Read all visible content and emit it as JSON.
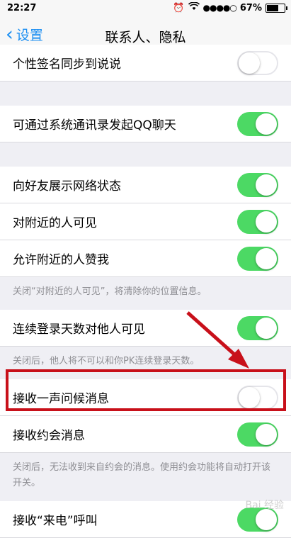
{
  "status_bar": {
    "time": "22:27",
    "signal_dots": "●●●●○",
    "battery": "67%",
    "battery_level": 0.67
  },
  "nav": {
    "back_label": "设置",
    "title": "联系人、隐私"
  },
  "sections": [
    {
      "rows": [
        {
          "label": "个性签名同步到说说",
          "on": false
        }
      ]
    },
    {
      "rows": [
        {
          "label": "可通过系统通讯录发起QQ聊天",
          "on": true
        }
      ]
    },
    {
      "rows": [
        {
          "label": "向好友展示网络状态",
          "on": true
        },
        {
          "label": "对附近的人可见",
          "on": true
        },
        {
          "label": "允许附近的人赞我",
          "on": true
        }
      ],
      "footer": "关闭“对附近的人可见”，将清除你的位置信息。"
    },
    {
      "rows": [
        {
          "label": "连续登录天数对他人可见",
          "on": true
        }
      ],
      "footer": "关闭后，他人将不可以和你PK连续登录天数。"
    },
    {
      "rows": [
        {
          "label": "接收一声问候消息",
          "on": false
        },
        {
          "label": "接收约会消息",
          "on": true
        }
      ],
      "footer": "关闭后，无法收到来自约会的消息。使用约会功能将自动打开该开关。"
    },
    {
      "rows": [
        {
          "label": "接收“来电”呼叫",
          "on": true
        }
      ]
    }
  ],
  "colors": {
    "accent": "#1a8ef2",
    "switch_on": "#4cd964",
    "highlight": "#c8101a"
  },
  "watermark": "Bai 经验"
}
